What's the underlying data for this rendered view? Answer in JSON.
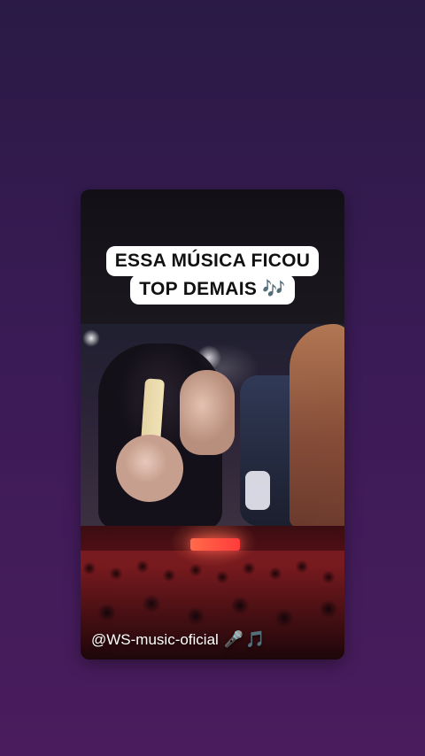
{
  "overlay": {
    "caption_line1": "ESSA MÚSICA FICOU",
    "caption_line2": "TOP DEMAIS 🎶",
    "watermark_text": "@WS-music-oficial",
    "watermark_icons": [
      "microphone-icon",
      "music-note-icon"
    ]
  },
  "colors": {
    "background_top": "#2a1a45",
    "background_bottom": "#4a1c5d",
    "caption_background": "#ffffff",
    "caption_text": "#111111",
    "watermark_text": "#ffffff",
    "stage_accent": "#ff3b3b"
  }
}
